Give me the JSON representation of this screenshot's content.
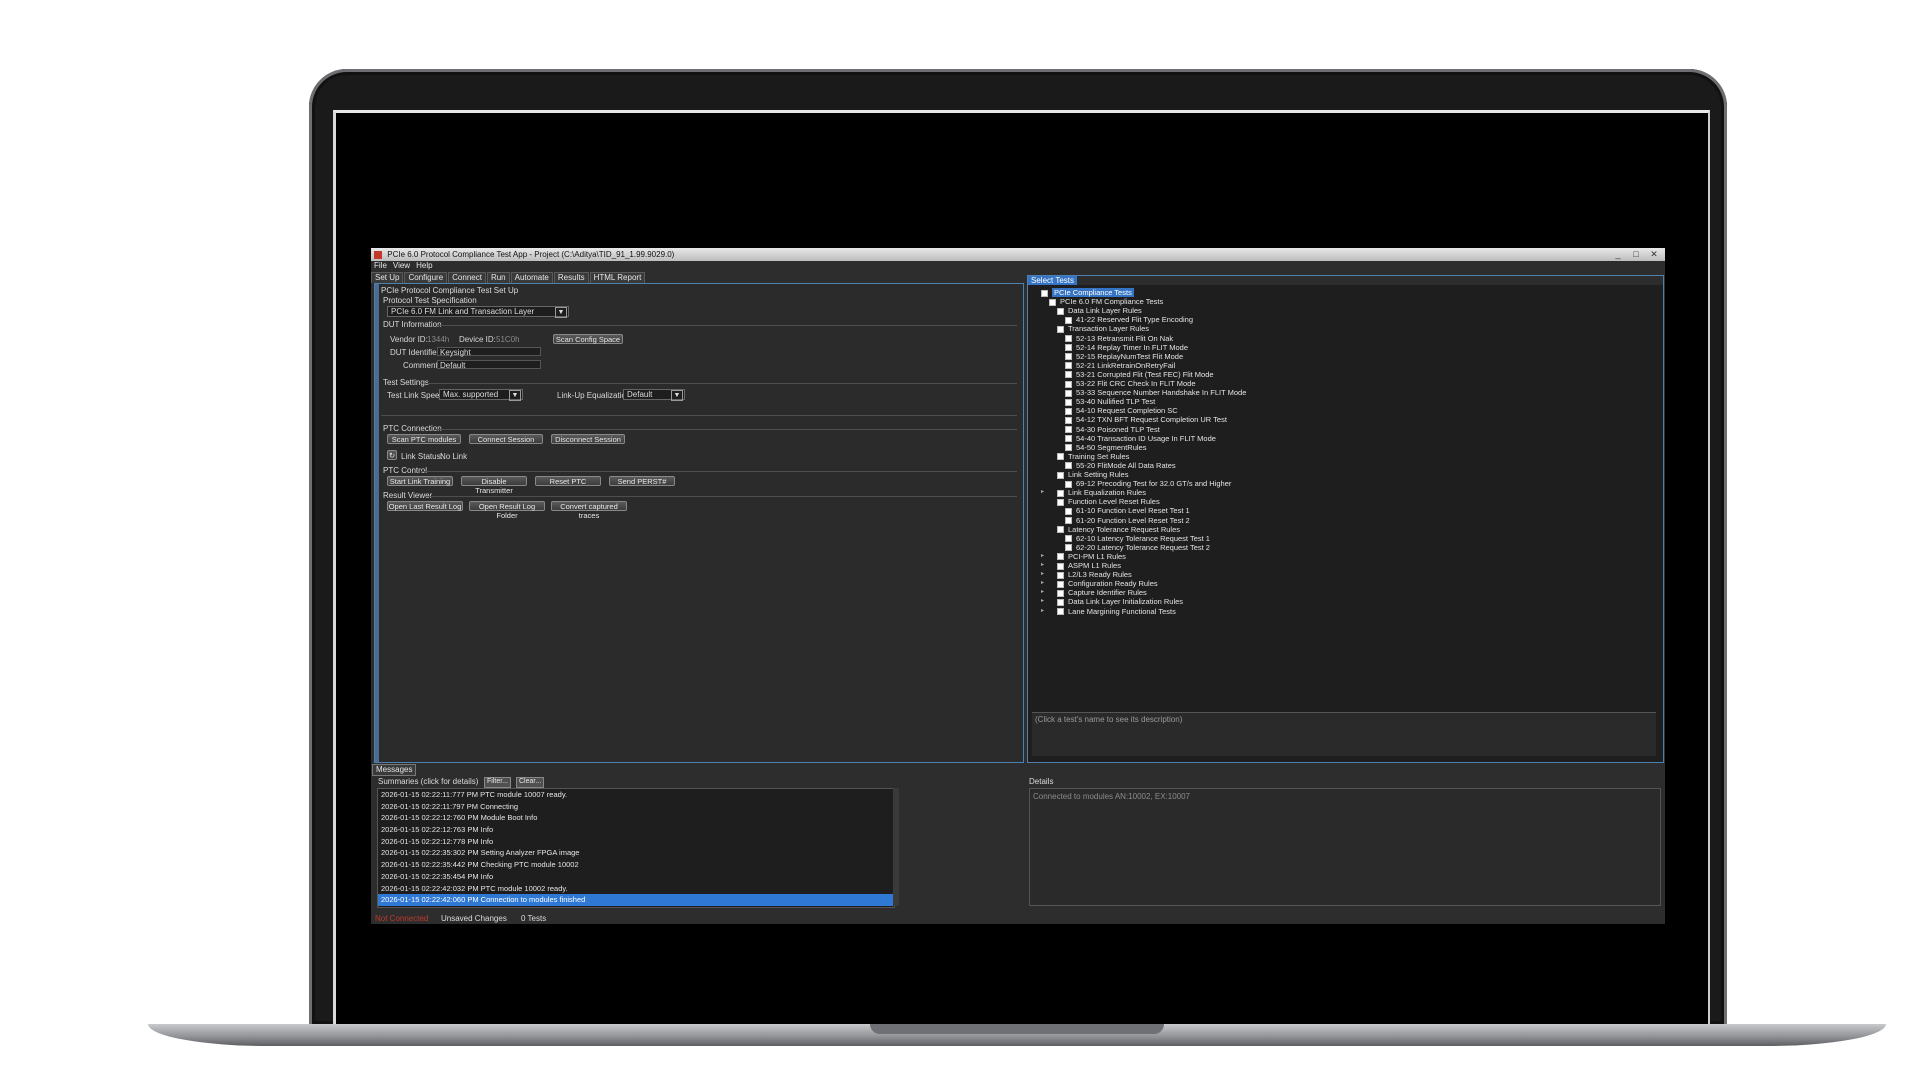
{
  "window": {
    "title": "PCIe 6.0 Protocol Compliance Test App - Project  (C:\\Aditya\\TID_91_1.99.9029.0)",
    "minimize": "_",
    "maximize": "□",
    "close": "✕"
  },
  "menu": [
    "File",
    "View",
    "Help"
  ],
  "tabs": [
    "Set Up",
    "Configure",
    "Connect",
    "Run",
    "Automate",
    "Results",
    "HTML Report"
  ],
  "setup": {
    "heading": "PCIe Protocol Compliance Test Set Up",
    "spec_label": "Protocol Test Specification",
    "spec_value": "PCIe 6.0 FM Link and Transaction Layer",
    "dut_label": "DUT Information",
    "vendor_id_label": "Vendor ID:",
    "vendor_id_value": "1344h",
    "device_id_label": "Device ID:",
    "device_id_value": "51C0h",
    "scan_config_button": "Scan Config Space",
    "dut_identifier_label": "DUT Identifier:",
    "dut_identifier_value": "Keysight",
    "comment_label": "Comment:",
    "comment_value": "Default",
    "test_settings_label": "Test Settings",
    "link_speed_label": "Test Link Speed:",
    "link_speed_value": "Max. supported",
    "linkup_eq_label": "Link-Up Equalization:",
    "linkup_eq_value": "Default",
    "ptc_connection_label": "PTC Connection",
    "scan_ptc_button": "Scan PTC modules",
    "connect_button": "Connect Session",
    "disconnect_button": "Disconnect Session",
    "link_status_label": "Link Status:",
    "link_status_value": "No Link",
    "ptc_control_label": "PTC Control",
    "start_link_button": "Start Link Training",
    "disable_tx_button": "Disable Transmitter",
    "reset_ptc_button": "Reset PTC",
    "send_perst_button": "Send PERST#",
    "result_viewer_label": "Result Viewer",
    "open_last_button": "Open Last Result Log",
    "open_folder_button": "Open Result Log Folder",
    "convert_button": "Convert captured traces"
  },
  "select_tests": {
    "tab_label": "Select Tests",
    "tree": [
      {
        "label": "PCIe Compliance Tests",
        "level": 0,
        "selected": true
      },
      {
        "label": "PCIe 6.0 FM Compliance Tests",
        "level": 1
      },
      {
        "label": "Data Link Layer Rules",
        "level": 2
      },
      {
        "label": "41-22 Reserved Flit Type Encoding",
        "level": 3
      },
      {
        "label": "Transaction Layer Rules",
        "level": 2
      },
      {
        "label": "52-13 Retransmit Flit On Nak",
        "level": 3
      },
      {
        "label": "52-14 Replay Timer In FLIT Mode",
        "level": 3
      },
      {
        "label": "52-15 ReplayNumTest Flit Mode",
        "level": 3
      },
      {
        "label": "52-21 LinkRetrainOnRetryFail",
        "level": 3
      },
      {
        "label": "53-21 Corrupted Flit (Test FEC) Flit Mode",
        "level": 3
      },
      {
        "label": "53-22 Flit CRC Check In FLIT Mode",
        "level": 3
      },
      {
        "label": "53-33 Sequence Number Handshake In FLIT Mode",
        "level": 3
      },
      {
        "label": "53-40 Nullified TLP Test",
        "level": 3
      },
      {
        "label": "54-10 Request Completion SC",
        "level": 3
      },
      {
        "label": "54-12 TXN BFT Request Completion UR Test",
        "level": 3
      },
      {
        "label": "54-30 Poisoned TLP Test",
        "level": 3
      },
      {
        "label": "54-40 Transaction ID Usage In FLIT Mode",
        "level": 3
      },
      {
        "label": "54-50 SegmentRules",
        "level": 3
      },
      {
        "label": "Training Set Rules",
        "level": 2
      },
      {
        "label": "55-20 FlitMode All Data Rates",
        "level": 3
      },
      {
        "label": "Link Setting Rules",
        "level": 2
      },
      {
        "label": "69-12 Precoding Test for 32.0 GT/s and Higher",
        "level": 3
      },
      {
        "label": "Link Equalization Rules",
        "level": 2,
        "collapsed": true
      },
      {
        "label": "Function Level Reset Rules",
        "level": 2
      },
      {
        "label": "61-10 Function Level Reset Test 1",
        "level": 3
      },
      {
        "label": "61-20 Function Level Reset Test 2",
        "level": 3
      },
      {
        "label": "Latency Tolerance Request Rules",
        "level": 2
      },
      {
        "label": "62-10 Latency Tolerance Request Test 1",
        "level": 3
      },
      {
        "label": "62-20 Latency Tolerance Request Test 2",
        "level": 3
      },
      {
        "label": "PCI-PM L1 Rules",
        "level": 2,
        "collapsed": true
      },
      {
        "label": "ASPM L1 Rules",
        "level": 2,
        "collapsed": true
      },
      {
        "label": "L2/L3 Ready Rules",
        "level": 2,
        "collapsed": true
      },
      {
        "label": "Configuration Ready Rules",
        "level": 2,
        "collapsed": true
      },
      {
        "label": "Capture Identifier Rules",
        "level": 2,
        "collapsed": true
      },
      {
        "label": "Data Link Layer Initialization Rules",
        "level": 2,
        "collapsed": true
      },
      {
        "label": "Lane Margining Functional Tests",
        "level": 2,
        "collapsed": true
      }
    ],
    "description_placeholder": "(Click a test's name to see its description)"
  },
  "messages": {
    "tab_label": "Messages",
    "summaries_label": "Summaries (click for details)",
    "filter_button": "Filter...",
    "clear_button": "Clear...",
    "log": [
      "2026-01-15 02:22:11:777 PM PTC module 10007 ready.",
      "2026-01-15 02:22:11:797 PM Connecting",
      "2026-01-15 02:22:12:760 PM Module Boot Info",
      "2026-01-15 02:22:12:763 PM Info",
      "2026-01-15 02:22:12:778 PM Info",
      "2026-01-15 02:22:35:302 PM Setting Analyzer FPGA image",
      "2026-01-15 02:22:35:442 PM Checking PTC module 10002",
      "2026-01-15 02:22:35:454 PM Info",
      "2026-01-15 02:22:42:032 PM PTC module 10002 ready.",
      "2026-01-15 02:22:42:060 PM Connection to modules finished"
    ],
    "details_label": "Details",
    "details_text": "Connected to modules AN:10002, EX:10007"
  },
  "statusbar": {
    "connection": "Not Connected",
    "unsaved": "Unsaved Changes",
    "tests": "0 Tests"
  },
  "colors": {
    "accent": "#3574c4",
    "highlight": "#2f79d4",
    "status_error": "#c0392b"
  }
}
